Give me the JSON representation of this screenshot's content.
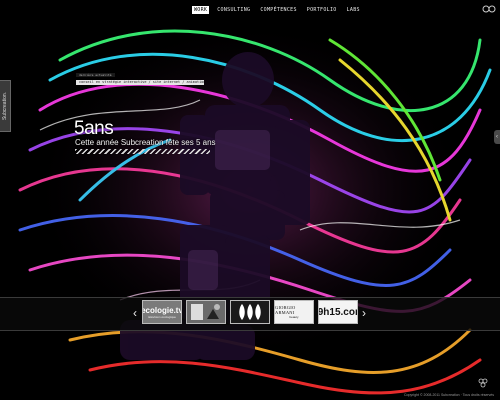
{
  "nav": {
    "items": [
      "work",
      "consulting",
      "compétences",
      "portfolio",
      "labs"
    ],
    "active_index": 0
  },
  "side_tab": {
    "label": "Subcreation."
  },
  "info": {
    "bar1": "dernière actualité",
    "bar2": "conseil en stratégie interactive / site internet / animation flash / jeux / communication"
  },
  "headline": {
    "title": "5ans",
    "subtitle": "Cette année Subcreation fête ses 5 ans"
  },
  "carousel": {
    "prev": "‹",
    "next": "›",
    "items": [
      {
        "main": "ecologie.tv",
        "sub": "télévision écologique"
      },
      {
        "main": ""
      },
      {
        "main": ""
      },
      {
        "main": "GIORGIO ARMANI",
        "sub": "beauty"
      },
      {
        "main": "09h15.com"
      }
    ]
  },
  "footer": {
    "copyright": "Copyright © 2008-2011 Subcreation · Tous droits réservés"
  },
  "colors": {
    "accent": "#ffffff",
    "band": "#0a0a0a"
  }
}
